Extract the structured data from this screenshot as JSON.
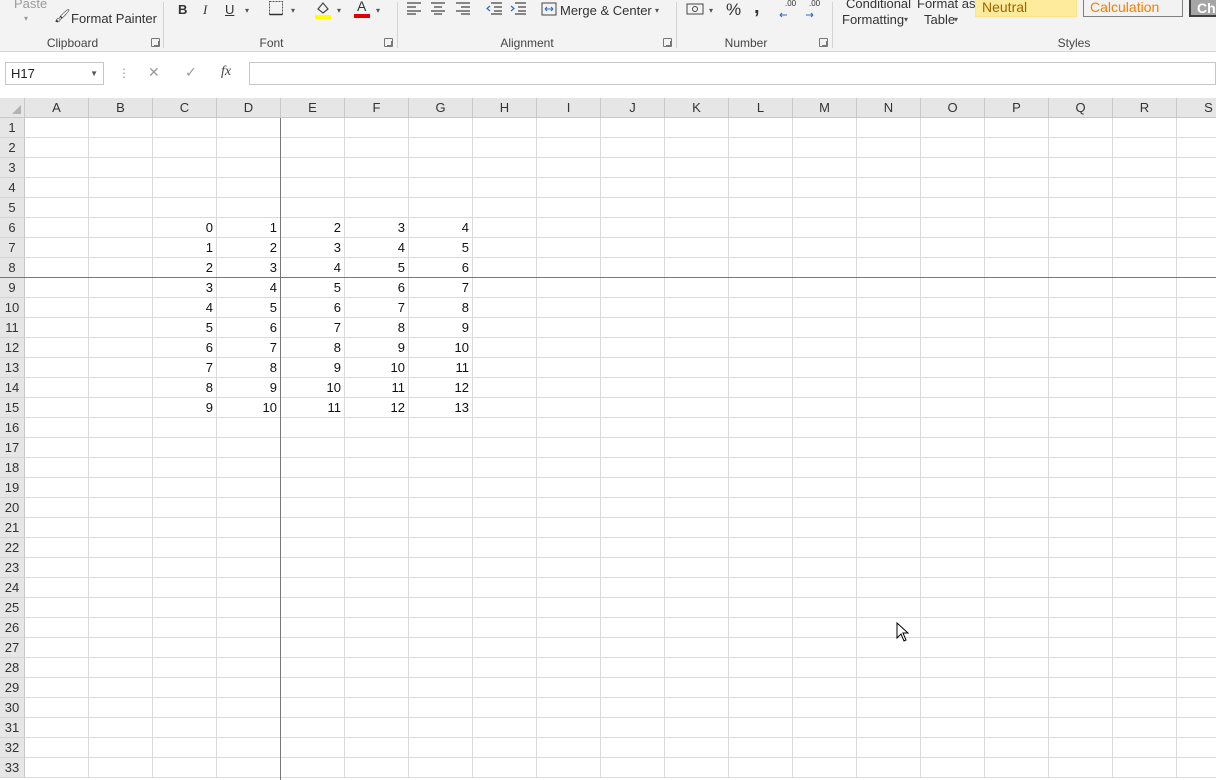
{
  "ribbon": {
    "clipboard": {
      "paste_label": "Paste",
      "format_painter_label": "Format Painter",
      "group_label": "Clipboard"
    },
    "font": {
      "bold_label": "B",
      "italic_label": "I",
      "underline_label": "U",
      "font_color_glyph": "A",
      "group_label": "Font"
    },
    "alignment": {
      "merge_center_label": "Merge & Center",
      "group_label": "Alignment"
    },
    "number": {
      "percent_label": "%",
      "comma_label": ",",
      "increase_decimal_label": ".00",
      "decrease_decimal_label": ".00",
      "group_label": "Number"
    },
    "styles": {
      "conditional_line1": "Conditional",
      "conditional_line2": "Formatting",
      "format_table_line1": "Format as",
      "format_table_line2": "Table",
      "neutral_label": "Neutral",
      "calculation_label": "Calculation",
      "check_label": "Che",
      "group_label": "Styles"
    }
  },
  "formula_bar": {
    "name_box": "H17",
    "cancel_glyph": "✕",
    "enter_glyph": "✓",
    "fx_label": "fx",
    "formula": ""
  },
  "grid": {
    "columns": [
      "A",
      "B",
      "C",
      "D",
      "E",
      "F",
      "G",
      "H",
      "I",
      "J",
      "K",
      "L",
      "M",
      "N",
      "O",
      "P",
      "Q",
      "R",
      "S"
    ],
    "rows": [
      "1",
      "2",
      "3",
      "4",
      "5",
      "6",
      "7",
      "8",
      "9",
      "10",
      "11",
      "12",
      "13",
      "14",
      "15",
      "16",
      "17",
      "18",
      "19",
      "20",
      "21",
      "22",
      "23",
      "24",
      "25",
      "26",
      "27",
      "28",
      "29",
      "30",
      "31",
      "32",
      "33"
    ],
    "data_start_row": 6,
    "data_columns": [
      "C",
      "D",
      "E",
      "F",
      "G"
    ],
    "values": [
      [
        0,
        1,
        2,
        3,
        4
      ],
      [
        1,
        2,
        3,
        4,
        5
      ],
      [
        2,
        3,
        4,
        5,
        6
      ],
      [
        3,
        4,
        5,
        6,
        7
      ],
      [
        4,
        5,
        6,
        7,
        8
      ],
      [
        5,
        6,
        7,
        8,
        9
      ],
      [
        6,
        7,
        8,
        9,
        10
      ],
      [
        7,
        8,
        9,
        10,
        11
      ],
      [
        8,
        9,
        10,
        11,
        12
      ],
      [
        9,
        10,
        11,
        12,
        13
      ]
    ]
  },
  "colors": {
    "neutral_fill": "#ffeb9c",
    "neutral_text": "#9c6500",
    "calculation_text": "#fa7d00",
    "check_fill": "#a5a5a5",
    "fill_color_bar": "#ffff00",
    "font_color_bar": "#e00000"
  }
}
